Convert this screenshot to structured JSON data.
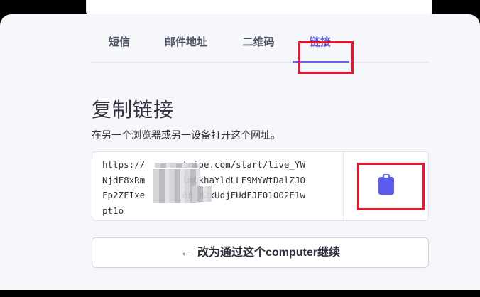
{
  "tabs": [
    {
      "label": "短信",
      "active": false
    },
    {
      "label": "邮件地址",
      "active": false
    },
    {
      "label": "二维码",
      "active": false
    },
    {
      "label": "链接",
      "active": true
    }
  ],
  "copy_link": {
    "title": "复制链接",
    "subtitle": "在另一个浏览器或另一设备打开这个网址。",
    "url_lines": [
      "https://       tripe.com/start/live_YW",
      "NjdF8xRm       lmQkhaYldLLF9MYWtDalZJO",
      "Fp2ZFIxe       6F5M2xUdjFUdFJF01002E1w",
      "pt1o"
    ],
    "copy_icon": "clipboard-icon"
  },
  "continue_button": {
    "arrow": "←",
    "label": "改为通过这个computer继续"
  },
  "colors": {
    "accent": "#5b5bd6",
    "highlight": "#e3172f",
    "text": "#30313d"
  }
}
